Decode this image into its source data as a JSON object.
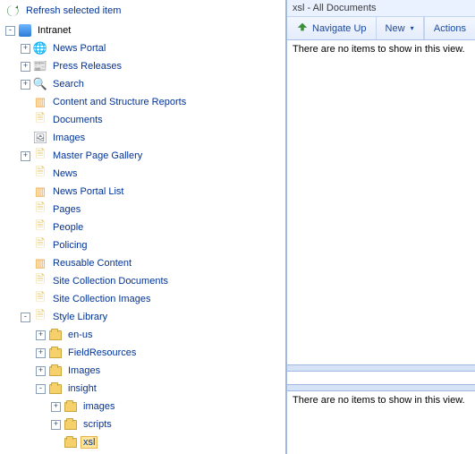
{
  "toolbar": {
    "refresh_label": "Refresh selected item"
  },
  "tree": {
    "root": "Intranet",
    "news_portal": "News Portal",
    "press_releases": "Press Releases",
    "search": "Search",
    "csr": "Content and Structure Reports",
    "documents": "Documents",
    "images": "Images",
    "master_page": "Master Page Gallery",
    "news": "News",
    "news_portal_list": "News Portal List",
    "pages": "Pages",
    "people": "People",
    "policing": "Policing",
    "reusable": "Reusable Content",
    "site_coll_docs": "Site Collection Documents",
    "site_coll_imgs": "Site Collection Images",
    "style_library": "Style Library",
    "en_us": "en-us",
    "field_resources": "FieldResources",
    "images_folder": "Images",
    "insight": "insight",
    "insight_images": "images",
    "insight_scripts": "scripts",
    "insight_xsl": "xsl"
  },
  "right": {
    "title": "xsl - All Documents",
    "nav_up": "Navigate Up",
    "new": "New",
    "actions": "Actions",
    "empty_msg": "There are no items to show in this view.",
    "lower_empty_msg": "There are no items to show in this view."
  }
}
